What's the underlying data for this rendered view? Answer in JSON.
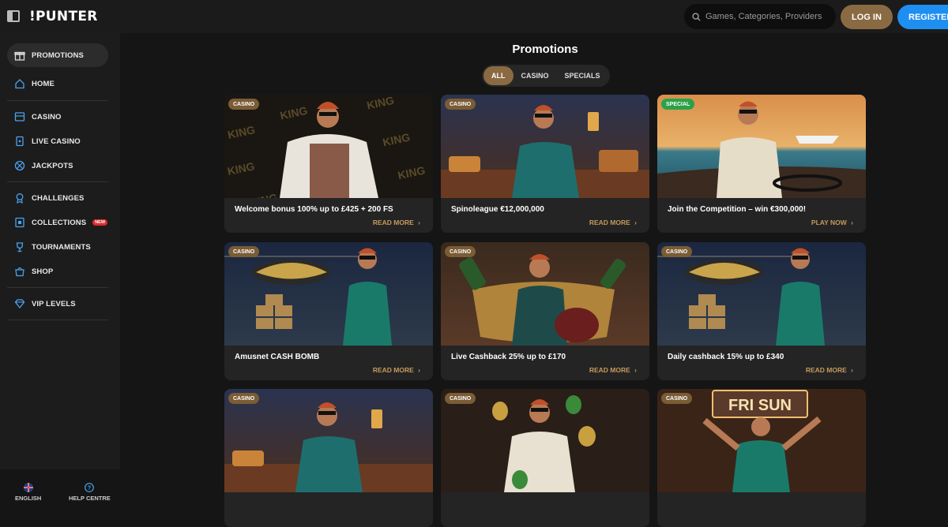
{
  "header": {
    "logo": "!PUNTER",
    "search_placeholder": "Games, Categories, Providers",
    "login_label": "LOG IN",
    "register_label": "REGISTER"
  },
  "sidebar": {
    "items": [
      {
        "label": "PROMOTIONS",
        "icon": "gift-icon"
      },
      {
        "label": "HOME",
        "icon": "home-icon"
      },
      {
        "label": "CASINO",
        "icon": "slot-machine-icon"
      },
      {
        "label": "LIVE CASINO",
        "icon": "card-icon"
      },
      {
        "label": "JACKPOTS",
        "icon": "jackpot-icon"
      },
      {
        "label": "CHALLENGES",
        "icon": "medal-icon"
      },
      {
        "label": "COLLECTIONS",
        "icon": "collection-icon",
        "badge": "NEW"
      },
      {
        "label": "TOURNAMENTS",
        "icon": "trophy-icon"
      },
      {
        "label": "SHOP",
        "icon": "shop-icon"
      },
      {
        "label": "VIP LEVELS",
        "icon": "diamond-icon"
      }
    ],
    "footer": {
      "language": "ENGLISH",
      "help": "HELP CENTRE"
    }
  },
  "main": {
    "title": "Promotions",
    "filters": [
      "ALL",
      "CASINO",
      "SPECIALS"
    ],
    "active_filter": "ALL",
    "cards": [
      {
        "tag": "CASINO",
        "title": "Welcome bonus 100% up to £425 + 200 FS",
        "action": "READ MORE"
      },
      {
        "tag": "CASINO",
        "title": "Spinoleague €12,000,000",
        "action": "READ MORE"
      },
      {
        "tag": "SPECIAL",
        "title": "Join the Competition – win €300,000!",
        "action": "PLAY NOW"
      },
      {
        "tag": "CASINO",
        "title": "Amusnet CASH BOMB",
        "action": "READ MORE"
      },
      {
        "tag": "CASINO",
        "title": "Live Cashback 25% up to £170",
        "action": "READ MORE"
      },
      {
        "tag": "CASINO",
        "title": "Daily cashback 15% up to £340",
        "action": "READ MORE"
      },
      {
        "tag": "CASINO",
        "title": "",
        "action": ""
      },
      {
        "tag": "CASINO",
        "title": "",
        "action": ""
      },
      {
        "tag": "CASINO",
        "title": "",
        "action": ""
      }
    ],
    "image_texts": {
      "card1_word": "KING",
      "card9_sign": "FRI SUN"
    }
  },
  "colors": {
    "accent_gold": "#8a6a42",
    "action_gold": "#c59a5c",
    "register_blue": "#1f8ef1",
    "special_green": "#2aa24a"
  }
}
